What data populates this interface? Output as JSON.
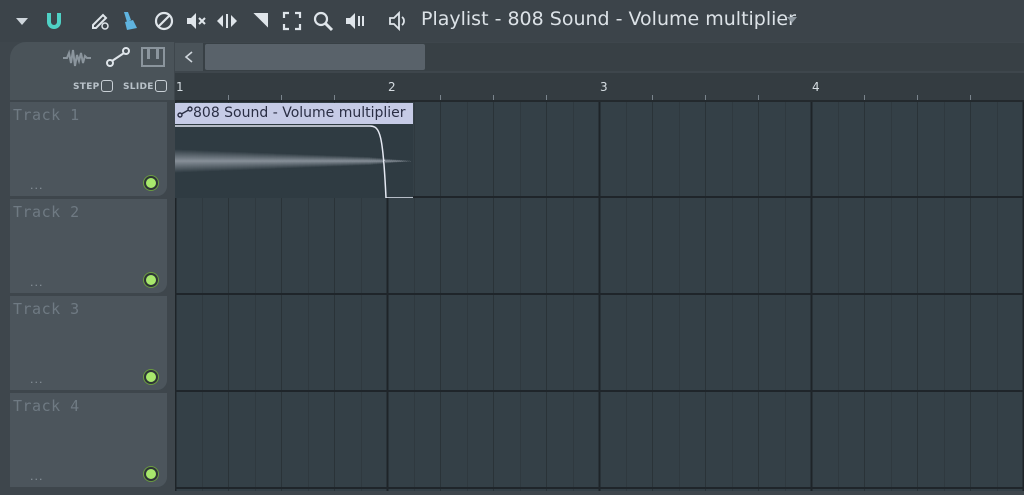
{
  "toolbar": {
    "icons": [
      "menu-arrow-icon",
      "magnet-icon",
      "pencil-icon",
      "paint-brush-icon",
      "delete-icon",
      "mute-icon",
      "slip-icon",
      "slice-icon",
      "select-icon",
      "zoom-icon",
      "playback-icon",
      "speaker-icon"
    ],
    "title": "Playlist - 808 Sound - Volume multiplier"
  },
  "header": {
    "step_label": "STEP",
    "slide_label": "SLIDE"
  },
  "ruler": {
    "bars": [
      "1",
      "2",
      "3",
      "4"
    ]
  },
  "tracks": [
    {
      "name": "Track 1",
      "dots": "..."
    },
    {
      "name": "Track 2",
      "dots": "..."
    },
    {
      "name": "Track 3",
      "dots": "..."
    },
    {
      "name": "Track 4",
      "dots": "..."
    }
  ],
  "clip": {
    "label": "808 Sound - Volume multiplier",
    "track": 1
  },
  "colors": {
    "led_green": "#a8e86c",
    "clip_header": "#c6cbe6",
    "accent_blue": "#5fb4e0",
    "magnet_teal": "#4fd1c5"
  }
}
